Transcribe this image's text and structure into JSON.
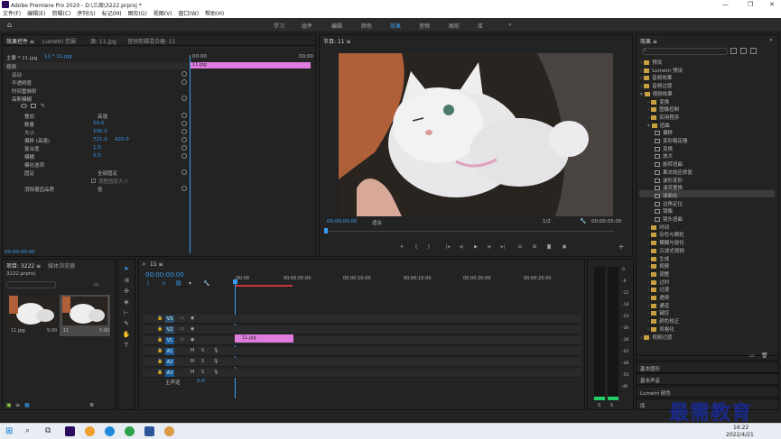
{
  "app": {
    "title": "Adobe Premiere Pro 2020 - D:\\三周\\3222.prproj *"
  },
  "menu": [
    "文件(F)",
    "编辑(E)",
    "剪辑(C)",
    "序列(S)",
    "标记(M)",
    "图形(G)",
    "视图(V)",
    "窗口(W)",
    "帮助(H)"
  ],
  "workspaces": [
    "学习",
    "组件",
    "编辑",
    "颜色",
    "效果",
    "音频",
    "图形",
    "库"
  ],
  "workspace_active": "效果",
  "effect_controls": {
    "tabs": [
      "效果控件 ≡",
      "Lumetri 范围",
      "源: 11.jpg",
      "音频剪辑混合器: 11"
    ],
    "source": "主要 * 11.jpg",
    "clip": "11 * 11.jpg",
    "video_label": "视频",
    "timecode_start": "00:00",
    "timecode_end": "00:00",
    "clip_bar": "11.jpg",
    "items": {
      "motion": "运动",
      "opacity": "不透明度",
      "time_remap": "时间重映射",
      "effect": "高斯模糊",
      "blur_mode": "叠加",
      "blur_mode_val": "高速",
      "amount": "数量",
      "amount_val": "50.0",
      "size": "大小",
      "size_val": "100.0",
      "offset": "偏移 (高速)",
      "offset_x": "721.0",
      "offset_y": "420.0",
      "blend": "复合度",
      "blend_val": "1.0",
      "blur": "模糊",
      "blur_val": "0.0",
      "blur_options": "模化选项",
      "fixed": "固定",
      "fixed_val": "全部固定",
      "adjust_size": "调整图层大小",
      "sample": "消除锯齿品质",
      "sample_val": "低"
    },
    "footer_time": "00:00:00:00"
  },
  "program": {
    "title": "节目: 11 ≡",
    "timecode": "00:00:00:00",
    "fit": "适合",
    "ratio": "1/2",
    "duration": "00:00:05:00"
  },
  "project": {
    "tabs": [
      "项目: 3222 ≡",
      "媒体浏览器"
    ],
    "file": "3222.prproj",
    "items": [
      {
        "name": "11.jpg",
        "dur": "5:00"
      },
      {
        "name": "11",
        "dur": "5:00"
      }
    ]
  },
  "timeline": {
    "tab": "11 ≡",
    "timecode": "00:00:00:00",
    "ruler": [
      ":00:00",
      "00:00:05:00",
      "00:00:10:00",
      "00:00:15:00",
      "00:00:20:00",
      "00:00:25:00"
    ],
    "tracks": [
      "V3",
      "V2",
      "V1",
      "A1",
      "A2",
      "A3"
    ],
    "master": "主声道",
    "master_val": "0.0",
    "clip": "11.jpg"
  },
  "effects": {
    "title": "效果 ≡",
    "rows": [
      {
        "t": "预设",
        "type": "f",
        "d": 0,
        "open": false
      },
      {
        "t": "Lumetri 预设",
        "type": "f",
        "d": 0,
        "open": false
      },
      {
        "t": "音频效果",
        "type": "f",
        "d": 0,
        "open": false
      },
      {
        "t": "音频过渡",
        "type": "f",
        "d": 0,
        "open": false
      },
      {
        "t": "视频效果",
        "type": "f",
        "d": 0,
        "open": true
      },
      {
        "t": "变换",
        "type": "f",
        "d": 1,
        "open": false
      },
      {
        "t": "图像控制",
        "type": "f",
        "d": 1,
        "open": false
      },
      {
        "t": "实用程序",
        "type": "f",
        "d": 1,
        "open": false
      },
      {
        "t": "扭曲",
        "type": "f",
        "d": 1,
        "open": true
      },
      {
        "t": "偏移",
        "type": "i",
        "d": 2
      },
      {
        "t": "变形稳定器",
        "type": "i",
        "d": 2
      },
      {
        "t": "变换",
        "type": "i",
        "d": 2
      },
      {
        "t": "放大",
        "type": "i",
        "d": 2
      },
      {
        "t": "旋转扭曲",
        "type": "i",
        "d": 2
      },
      {
        "t": "果冻效应修复",
        "type": "i",
        "d": 2
      },
      {
        "t": "波形变形",
        "type": "i",
        "d": 2
      },
      {
        "t": "湍流置换",
        "type": "i",
        "d": 2,
        "sel": true
      },
      {
        "t": "球面化",
        "type": "i",
        "d": 2
      },
      {
        "t": "边角定位",
        "type": "i",
        "d": 2
      },
      {
        "t": "镜像",
        "type": "i",
        "d": 2
      },
      {
        "t": "镜头扭曲",
        "type": "i",
        "d": 2
      },
      {
        "t": "时间",
        "type": "f",
        "d": 1,
        "open": false
      },
      {
        "t": "杂色与颗粒",
        "type": "f",
        "d": 1,
        "open": false
      },
      {
        "t": "模糊与锐化",
        "type": "f",
        "d": 1,
        "open": false
      },
      {
        "t": "沉浸式视频",
        "type": "f",
        "d": 1,
        "open": false
      },
      {
        "t": "生成",
        "type": "f",
        "d": 1,
        "open": false
      },
      {
        "t": "视频",
        "type": "f",
        "d": 1,
        "open": false
      },
      {
        "t": "调整",
        "type": "f",
        "d": 1,
        "open": false
      },
      {
        "t": "过时",
        "type": "f",
        "d": 1,
        "open": false
      },
      {
        "t": "过渡",
        "type": "f",
        "d": 1,
        "open": false
      },
      {
        "t": "透视",
        "type": "f",
        "d": 1,
        "open": false
      },
      {
        "t": "通道",
        "type": "f",
        "d": 1,
        "open": false
      },
      {
        "t": "键控",
        "type": "f",
        "d": 1,
        "open": false
      },
      {
        "t": "颜色校正",
        "type": "f",
        "d": 1,
        "open": false
      },
      {
        "t": "风格化",
        "type": "f",
        "d": 1,
        "open": false
      },
      {
        "t": "视频过渡",
        "type": "f",
        "d": 0,
        "open": false
      }
    ],
    "bottom": [
      "基本图形",
      "基本声音",
      "Lumetri 颜色",
      "库"
    ]
  },
  "audio_meter": {
    "labels": [
      "0",
      "-6",
      "-12",
      "-18",
      "-24",
      "-30",
      "-36",
      "-42",
      "-48",
      "-54",
      "dB"
    ],
    "bottom": [
      "S",
      "S"
    ]
  },
  "watermark": "最需教育",
  "taskbar": {
    "time": "16:22",
    "date": "2022/4/21"
  }
}
